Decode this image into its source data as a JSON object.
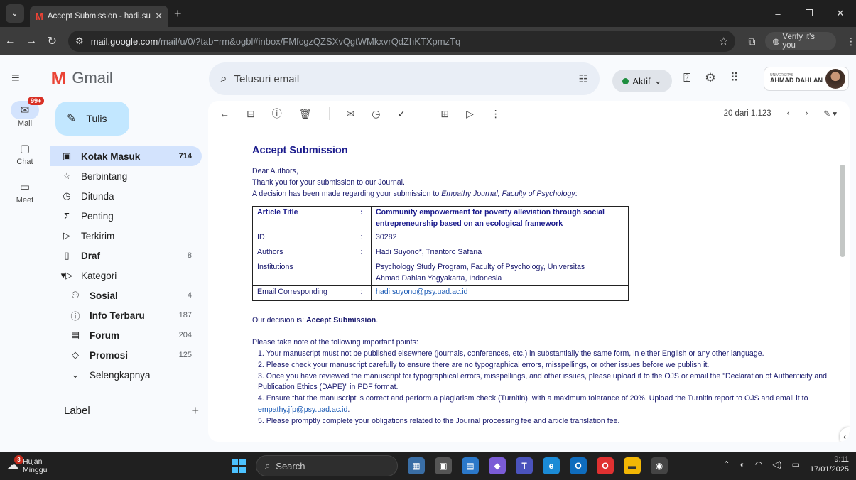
{
  "browser": {
    "tab_title": "Accept Submission - hadi.suyon",
    "url_host": "mail.google.com",
    "url_path": "/mail/u/0/?tab=rm&ogbl#inbox/FMfcgzQZSXvQgtWMkxvrQdZhKTXpmzTq",
    "verify_label": "Verify it's you"
  },
  "gmail": {
    "app_name": "Gmail",
    "search_placeholder": "Telusuri email",
    "status_label": "Aktif",
    "org_name": "AHMAD DAHLAN",
    "org_sub": "UNIVERSITAS"
  },
  "rail": {
    "mail_label": "Mail",
    "mail_badge": "99+",
    "chat_label": "Chat",
    "meet_label": "Meet"
  },
  "compose_label": "Tulis",
  "nav": [
    {
      "label": "Kotak Masuk",
      "count": "714",
      "icon": "inbox-icon",
      "glyph": "▣",
      "active": true,
      "bold": true
    },
    {
      "label": "Berbintang",
      "count": "",
      "icon": "star-icon",
      "glyph": "☆"
    },
    {
      "label": "Ditunda",
      "count": "",
      "icon": "clock-icon",
      "glyph": "◷"
    },
    {
      "label": "Penting",
      "count": "",
      "icon": "important-icon",
      "glyph": "Σ"
    },
    {
      "label": "Terkirim",
      "count": "",
      "icon": "send-icon",
      "glyph": "▷"
    },
    {
      "label": "Draf",
      "count": "8",
      "icon": "draft-icon",
      "glyph": "▯",
      "bold": true
    },
    {
      "label": "Kategori",
      "count": "",
      "icon": "category-icon",
      "glyph": "▾▷"
    },
    {
      "label": "Sosial",
      "count": "4",
      "icon": "people-icon",
      "glyph": "⚇",
      "sub": true,
      "bold": true
    },
    {
      "label": "Info Terbaru",
      "count": "187",
      "icon": "info-icon",
      "glyph": "ⓘ",
      "sub": true,
      "bold": true
    },
    {
      "label": "Forum",
      "count": "204",
      "icon": "forum-icon",
      "glyph": "▤",
      "sub": true,
      "bold": true
    },
    {
      "label": "Promosi",
      "count": "125",
      "icon": "tag-icon",
      "glyph": "◇",
      "sub": true,
      "bold": true
    },
    {
      "label": "Selengkapnya",
      "count": "",
      "icon": "chevron-down-icon",
      "glyph": "⌄",
      "sub": true
    }
  ],
  "label_heading": "Label",
  "toolbar": {
    "pager": "20 dari 1.123"
  },
  "email": {
    "heading": "Accept Submission",
    "greeting": "Dear Authors,",
    "line1": "Thank you for your submission to our Journal.",
    "line2_prefix": "A decision has been made regarding your submission to ",
    "line2_journal": "Empathy Journal, Faculty of Psychology",
    "line2_suffix": ":",
    "table": {
      "title_label": "Article Title",
      "title_value": "Community empowerment for poverty alleviation through social entrepreneurship based on an ecological framework",
      "id_label": "ID",
      "id_value": "30282",
      "authors_label": "Authors",
      "authors_value": "Hadi Suyono*, Triantoro Safaria",
      "institutions_label": "Institutions",
      "institutions_value1": "Psychology Study Program, Faculty of Psychology, Universitas",
      "institutions_value2": "Ahmad Dahlan Yogyakarta, Indonesia",
      "email_label": "Email Corresponding",
      "email_value": "hadi.suyono@psy.uad.ac.id",
      "colon": ":"
    },
    "decision_prefix": "Our decision is: ",
    "decision_value": "Accept Submission",
    "decision_suffix": ".",
    "points_intro": "Please take note of the following important points:",
    "point1": "1.   Your manuscript must not be published elsewhere (journals, conferences, etc.) in substantially the same form, in either English or any other language.",
    "point2": "2.   Please check your manuscript carefully to ensure there are no typographical errors, misspellings, or other issues before we publish it.",
    "point3": "3.   Once you have reviewed the manuscript for typographical errors, misspellings, and other issues, please upload it to the OJS or email the \"Declaration of Authenticity and Publication Ethics (DAPE)\" in PDF format.",
    "point4_prefix": "4.   Ensure that the manuscript is correct and perform a plagiarism check (Turnitin), with a maximum tolerance of 20%. Upload the Turnitin report to OJS and email it to ",
    "point4_email": "empathy.jfp@psy.uad.ac.id",
    "point4_suffix": ".",
    "point5": "5.   Please promptly complete your obligations related to the Journal processing fee and article translation fee."
  },
  "taskbar": {
    "weather_title": "Hujan",
    "weather_sub": "Minggu",
    "weather_badge": "3",
    "search_label": "Search",
    "time": "9:11",
    "date": "17/01/2025"
  }
}
